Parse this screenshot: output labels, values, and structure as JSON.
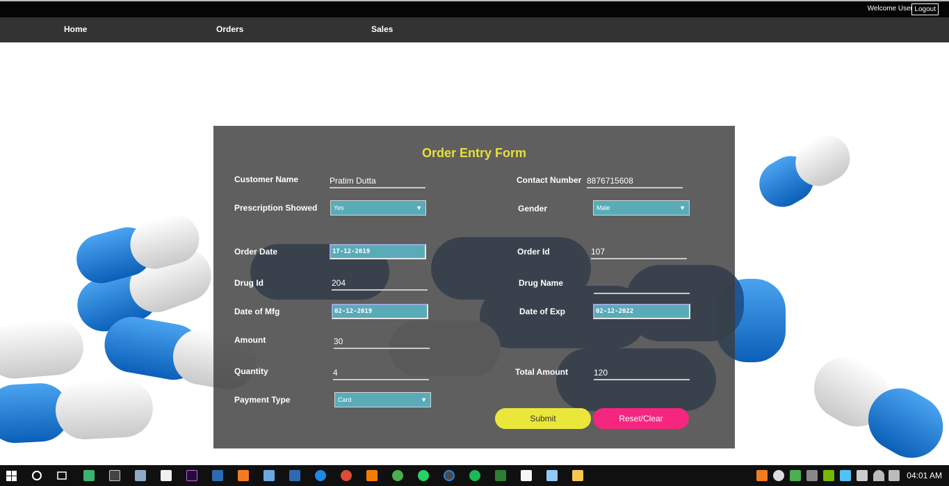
{
  "header": {
    "welcome": "Welcome User",
    "logout": "Logout"
  },
  "nav": {
    "home": "Home",
    "orders": "Orders",
    "sales": "Sales"
  },
  "form": {
    "title": "Order Entry Form",
    "customer_name_label": "Customer Name",
    "customer_name_value": "Pratim Dutta",
    "contact_number_label": "Contact Number",
    "contact_number_value": "8876715608",
    "prescription_label": "Prescription Showed",
    "prescription_value": "Yes",
    "gender_label": "Gender",
    "gender_value": "Male",
    "order_date_label": "Order Date",
    "order_date_value": "17-12-2019",
    "order_id_label": "Order Id",
    "order_id_value": "107",
    "drug_id_label": "Drug Id",
    "drug_id_value": "204",
    "drug_name_label": "Drug Name",
    "drug_name_value": "",
    "mfg_label": "Date of Mfg",
    "mfg_value": "02-12-2019",
    "exp_label": "Date of Exp",
    "exp_value": "02-12-2022",
    "amount_label": "Amount",
    "amount_value": "30",
    "quantity_label": "Quantity",
    "quantity_value": "4",
    "total_label": "Total Amount",
    "total_value": "120",
    "payment_label": "Payment Type",
    "payment_value": "Card",
    "submit": "Submit",
    "reset": "Reset/Clear"
  },
  "taskbar": {
    "clock": "04:01 AM"
  },
  "colors": {
    "title": "#eadf3a",
    "submit": "#eae73a",
    "reset": "#f5267f",
    "select_bg": "#5aabb8"
  }
}
